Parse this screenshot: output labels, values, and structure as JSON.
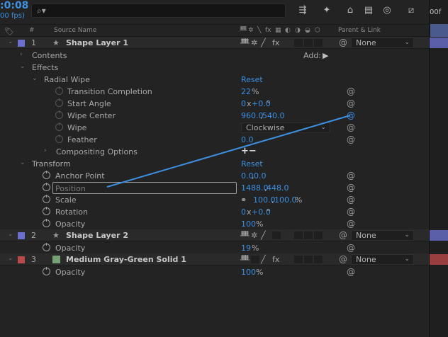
{
  "top": {
    "timecode": ":0:08",
    "fps": "00 fps)",
    "search_placeholder": "",
    "timeline_time": "00f"
  },
  "header": {
    "source_name": "Source Name",
    "hash": "#",
    "parent_link": "Parent & Link",
    "switch_fx": "fx"
  },
  "layers": [
    {
      "num": "1",
      "name": "Shape Layer 1",
      "parent": "None",
      "color": "#6b6fcf"
    },
    {
      "num": "2",
      "name": "Shape Layer 2",
      "parent": "None",
      "color": "#6b6fcf"
    },
    {
      "num": "3",
      "name": "Medium Gray-Green Solid 1",
      "parent": "None",
      "color": "#b84a4a"
    }
  ],
  "labels": {
    "contents": "Contents",
    "add": "Add:",
    "effects": "Effects",
    "radial_wipe": "Radial Wipe",
    "reset": "Reset",
    "transition_completion": "Transition Completion",
    "start_angle": "Start Angle",
    "wipe_center": "Wipe Center",
    "wipe": "Wipe",
    "feather": "Feather",
    "compositing_options": "Compositing Options",
    "transform": "Transform",
    "anchor_point": "Anchor Point",
    "position": "Position",
    "scale": "Scale",
    "rotation": "Rotation",
    "opacity": "Opacity",
    "pct": "%",
    "plus_minus": "+−"
  },
  "values": {
    "transition_completion": "22",
    "start_angle_rev": "0",
    "start_angle_x": "x",
    "start_angle_deg": "+0.0",
    "degree": "°",
    "wipe_center_x": "960.0",
    "wipe_center_y": "540.0",
    "wipe_mode": "Clockwise",
    "feather": "0.0",
    "anchor_x": "0.0",
    "anchor_y": "0.0",
    "position_x": "1488.0",
    "position_y": "448.0",
    "scale_x": "100.0",
    "scale_y": "100.0",
    "rotation_rev": "0",
    "rotation_deg": "+0.0",
    "opacity1": "100",
    "opacity2": "19",
    "opacity3": "100",
    "comma": ","
  },
  "colors": {
    "accent": "#3d8fe0",
    "pickwhip": "#3d8fe0"
  }
}
